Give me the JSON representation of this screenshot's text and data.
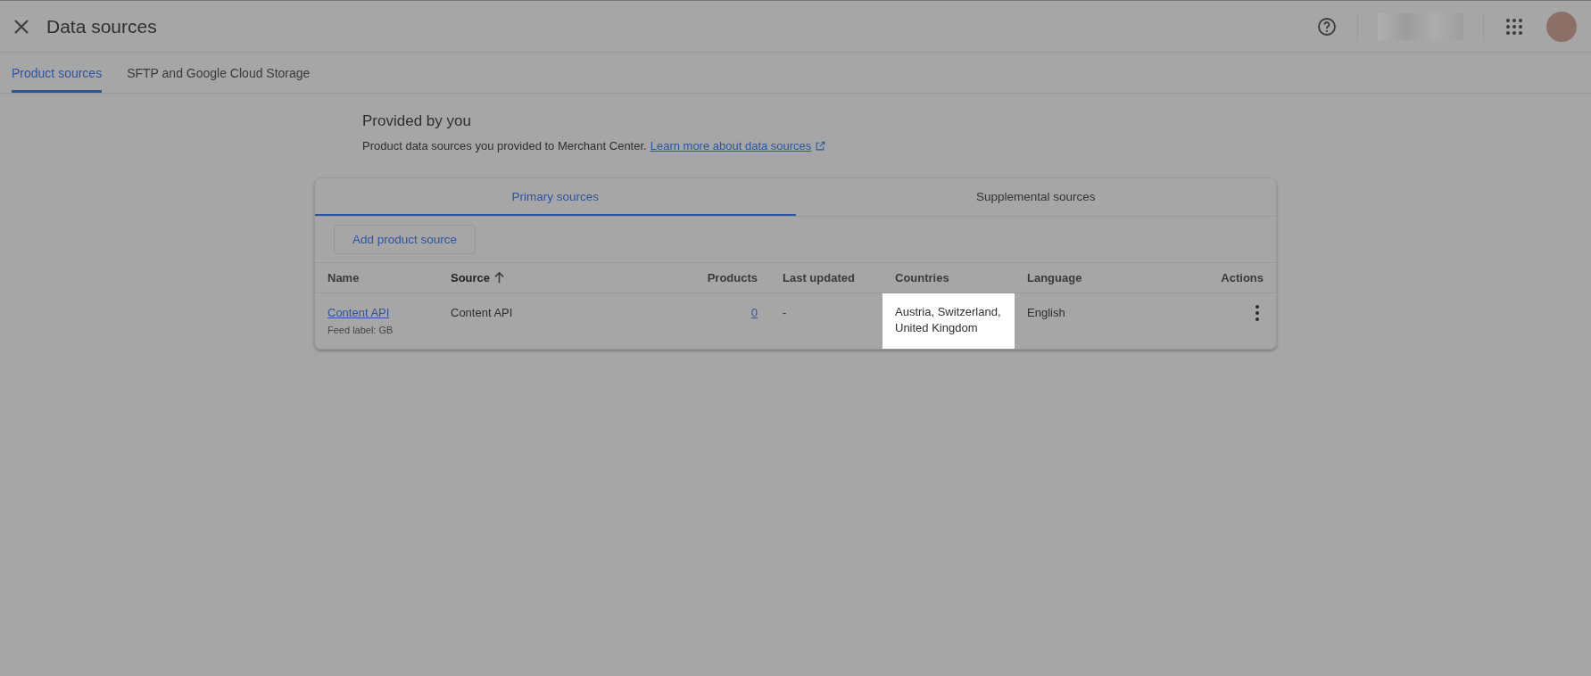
{
  "header": {
    "title": "Data sources"
  },
  "tabs": [
    {
      "label": "Product sources",
      "selected": true
    },
    {
      "label": "SFTP and Google Cloud Storage",
      "selected": false
    }
  ],
  "section": {
    "heading": "Provided by you",
    "description": "Product data sources you provided to Merchant Center.",
    "link": "Learn more about data sources"
  },
  "card_tabs": [
    {
      "label": "Primary sources",
      "selected": true
    },
    {
      "label": "Supplemental sources",
      "selected": false
    }
  ],
  "add_button": "Add product source",
  "table": {
    "columns": [
      {
        "label": "Name",
        "sorted": false
      },
      {
        "label": "Source",
        "sorted": true
      },
      {
        "label": "Products",
        "sorted": false
      },
      {
        "label": "Last updated",
        "sorted": false
      },
      {
        "label": "Countries",
        "sorted": false
      },
      {
        "label": "Language",
        "sorted": false
      },
      {
        "label": "Actions",
        "sorted": false
      }
    ],
    "rows": [
      {
        "name": "Content API",
        "feed_label": "Feed label: GB",
        "source": "Content API",
        "products": "0",
        "last_updated": "-",
        "countries": "Austria, Switzerland, United Kingdom",
        "countries_highlighted": true,
        "language": "English"
      }
    ]
  }
}
